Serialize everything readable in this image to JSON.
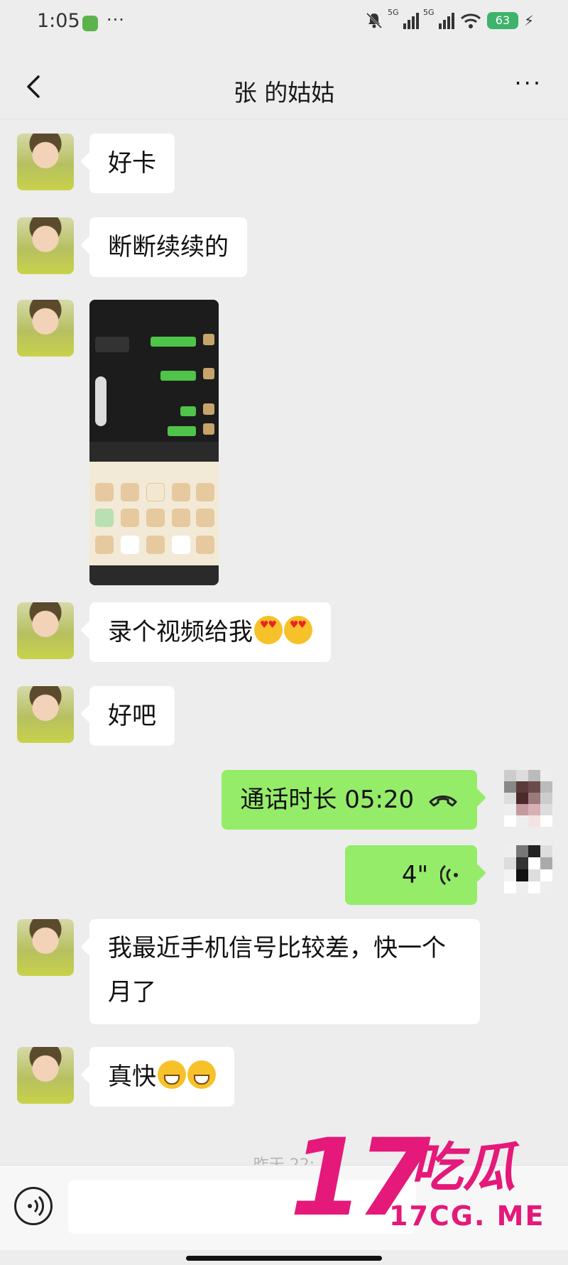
{
  "status_bar": {
    "time": "1:05",
    "dots": "···",
    "network_1": "5G",
    "network_2": "5G",
    "battery": "63",
    "bolt": "⚡"
  },
  "nav": {
    "title": "张  的姑姑",
    "more": "···"
  },
  "messages": [
    {
      "side": "left",
      "type": "text",
      "text": "好卡"
    },
    {
      "side": "left",
      "type": "text",
      "text": "断断续续的"
    },
    {
      "side": "left",
      "type": "image"
    },
    {
      "side": "left",
      "type": "text",
      "text": "录个视频给我",
      "emoji": [
        "heart-eyes-emoji",
        "heart-eyes-emoji"
      ]
    },
    {
      "side": "left",
      "type": "text",
      "text": "好吧"
    },
    {
      "side": "right",
      "type": "call",
      "label": "通话时长 05:20"
    },
    {
      "side": "right",
      "type": "voice",
      "duration": "4\""
    },
    {
      "side": "left",
      "type": "text",
      "text": "我最近手机信号比较差，快一个月了"
    },
    {
      "side": "left",
      "type": "text",
      "text": "真快",
      "emoji": [
        "grin-emoji",
        "grin-emoji"
      ]
    }
  ],
  "time_hint": "昨天 22:",
  "watermark": {
    "number": "17",
    "chinese": "吃瓜",
    "url": "17CG. ME"
  },
  "colors": {
    "background": "#ededed",
    "my_bubble": "#95ec69",
    "their_bubble": "#ffffff",
    "watermark": "#e4197a"
  }
}
